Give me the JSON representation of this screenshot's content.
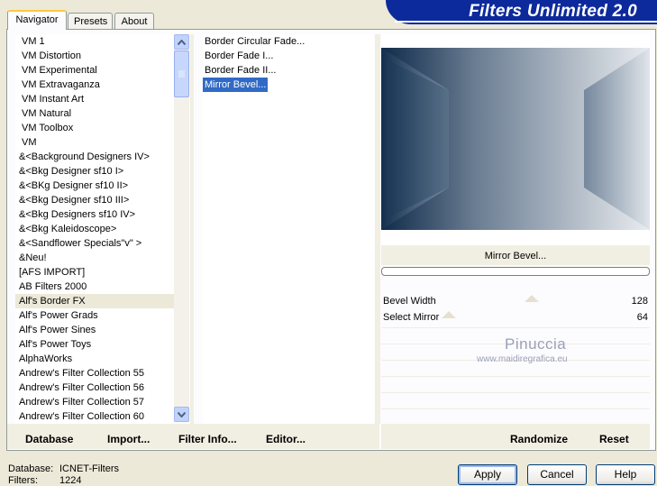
{
  "tabs": [
    {
      "label": "Navigator",
      "active": true
    },
    {
      "label": "Presets",
      "active": false
    },
    {
      "label": "About",
      "active": false
    }
  ],
  "banner": {
    "title": "Filters Unlimited 2.0"
  },
  "categories": [
    "VM 1",
    "VM Distortion",
    "VM Experimental",
    "VM Extravaganza",
    "VM Instant Art",
    "VM Natural",
    "VM Toolbox",
    "VM",
    "&<Background Designers IV>",
    "&<Bkg Designer sf10 I>",
    "&<BKg Designer sf10 II>",
    "&<Bkg Designer sf10 III>",
    "&<Bkg Designers sf10 IV>",
    "&<Bkg Kaleidoscope>",
    "&<Sandflower Specials\"v\" >",
    "&Neu!",
    "[AFS IMPORT]",
    "AB Filters 2000",
    "Alf's Border FX",
    "Alf's Power Grads",
    "Alf's Power Sines",
    "Alf's Power Toys",
    "AlphaWorks",
    "Andrew's Filter Collection 55",
    "Andrew's Filter Collection 56",
    "Andrew's Filter Collection 57",
    "Andrew's Filter Collection 60"
  ],
  "selected_category": "Alf's Border FX",
  "filters": [
    "Border Circular Fade...",
    "Border Fade I...",
    "Border Fade II...",
    "Mirror Bevel..."
  ],
  "selected_filter": "Mirror Bevel...",
  "toolbar": {
    "database": "Database",
    "import": "Import...",
    "filter_info": "Filter Info...",
    "editor": "Editor..."
  },
  "preview": {
    "filter_name": "Mirror Bevel...",
    "colors": {
      "dark": "#0f2a4a",
      "mid": "#6a7d92",
      "light": "#e9ecef"
    }
  },
  "sliders": [
    {
      "label": "Bevel Width",
      "value": "128",
      "level": 0.5
    },
    {
      "label": "Select Mirror",
      "value": "64",
      "level": 0.0
    }
  ],
  "watermark": {
    "name": "Pinuccia",
    "url": "www.maidiregrafica.eu"
  },
  "actions": {
    "randomize": "Randomize",
    "reset": "Reset"
  },
  "status": {
    "database_label": "Database:",
    "database_value": "ICNET-Filters",
    "filters_label": "Filters:",
    "filters_value": "1224"
  },
  "buttons": {
    "apply": "Apply",
    "cancel": "Cancel",
    "help": "Help"
  }
}
